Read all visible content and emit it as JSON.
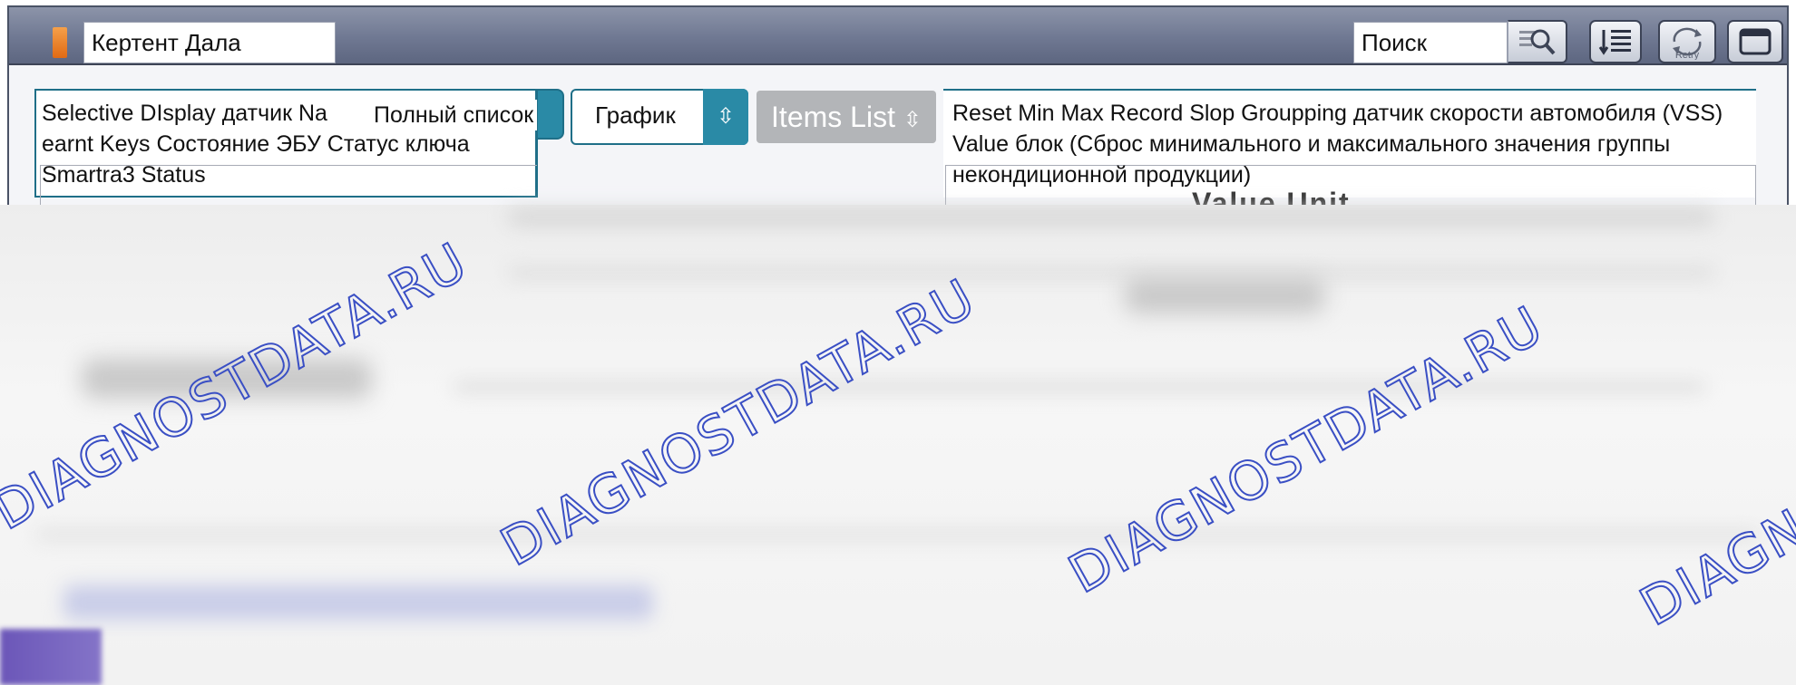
{
  "titlebar": {
    "title": "Кертент Дала",
    "search_label": "Поиск",
    "icons": [
      "search-icon",
      "list-icon",
      "retry-icon",
      "window-icon"
    ],
    "retry_label": "Retry"
  },
  "left_panel": {
    "text": "Selective DIsplay датчик Na\nearnt Keys Состояние ЭБУ Статус ключа\nSmartra3 Status",
    "overlay_label": "Полный список"
  },
  "controls": {
    "graph_select": "График",
    "items_list": "Items List"
  },
  "right_panel": {
    "text": "Reset Min Max Record Slop Groupping датчик скорости автомобиля (VSS) Value блок (Сброс минимального и максимального значения группы некондиционной продукции)",
    "column_header": "Value Unit"
  },
  "watermarks": [
    "DIAGNOSTDATA.RU",
    "DIAGNOSTDATA.RU",
    "DIAGNOSTDATA.RU",
    "DIAGNOSTDATA.RU"
  ],
  "colors": {
    "accent": "#2a8aa6",
    "titlebar": "#6f7892",
    "watermark": "#3a4fc4",
    "disabled": "#b3b5b8"
  }
}
